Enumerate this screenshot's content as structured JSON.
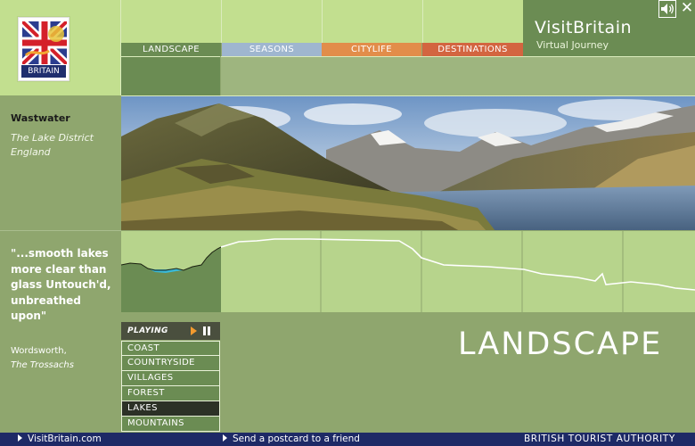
{
  "brand": {
    "title": "VisitBritain",
    "subtitle": "Virtual Journey",
    "logo_text": "BRITAIN"
  },
  "tabs": [
    {
      "label": "LANDSCAPE"
    },
    {
      "label": "SEASONS"
    },
    {
      "label": "CITYLIFE"
    },
    {
      "label": "DESTINATIONS"
    }
  ],
  "location": {
    "name": "Wastwater",
    "region": "The Lake District",
    "country": "England"
  },
  "quote": {
    "text": "\"...smooth lakes more clear than glass Untouch'd, unbreathed upon\"",
    "author": "Wordsworth,",
    "work": "The Trossachs"
  },
  "player": {
    "status": "PLAYING"
  },
  "playlist": [
    {
      "label": "COAST"
    },
    {
      "label": "COUNTRYSIDE"
    },
    {
      "label": "VILLAGES"
    },
    {
      "label": "FOREST"
    },
    {
      "label": "LAKES"
    },
    {
      "label": "MOUNTAINS"
    }
  ],
  "active_item": "LAKES",
  "section_title": "LANDSCAPE",
  "footer": {
    "link1": "VisitBritain.com",
    "link2": "Send a postcard to a friend",
    "org": "BRITISH TOURIST AUTHORITY"
  },
  "icons": {
    "sound": "speaker-icon",
    "close": "close-icon",
    "play": "play-icon",
    "pause": "pause-icon"
  },
  "colors": {
    "green_dark": "#6b8c53",
    "green_light": "#c2df8f",
    "seasons": "#9fb6cf",
    "citylife": "#e28d4a",
    "destinations": "#d36540",
    "navy": "#1e2a66"
  }
}
